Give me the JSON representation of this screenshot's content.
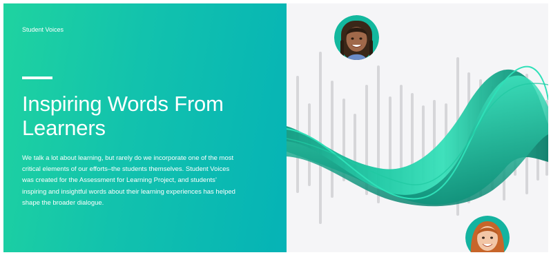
{
  "hero": {
    "eyebrow": "Student Voices",
    "heading": "Inspiring Words From Learners",
    "body": "We talk a lot about learning, but rarely do we incorporate one of the most critical elements of our efforts–the students themselves. Student Voices was created for the Assessment for Learning Project, and students’ inspiring and insightful words about their learning experiences has helped shape the broader dialogue."
  },
  "colors": {
    "gradient_start": "#1fd3a0",
    "gradient_end": "#05b3b6",
    "wave_light": "#2fe0b8",
    "wave_dark": "#0c8a74",
    "bar_gray": "#d6d6d9"
  },
  "icons": {
    "student_top": "student-avatar-icon",
    "student_bottom": "student-avatar-icon"
  }
}
